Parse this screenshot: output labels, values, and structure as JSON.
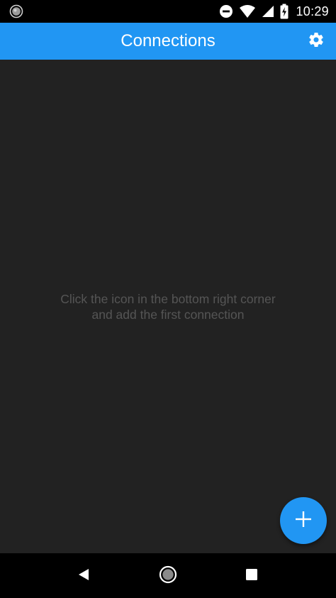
{
  "status_bar": {
    "time": "10:29",
    "icons": [
      "notification-dot-icon",
      "do-not-disturb-icon",
      "wifi-icon",
      "cell-signal-icon",
      "battery-charging-icon"
    ]
  },
  "app_bar": {
    "title": "Connections",
    "settings_icon": "gear-icon",
    "color": "#2196f3"
  },
  "main": {
    "background": "#222222",
    "empty_state": {
      "line1": "Click the icon in the bottom right corner",
      "line2": "and add the first connection"
    }
  },
  "fab": {
    "icon": "plus-icon",
    "color": "#2196f3"
  },
  "nav_bar": {
    "icons": [
      "back-icon",
      "home-icon",
      "recents-icon"
    ]
  }
}
